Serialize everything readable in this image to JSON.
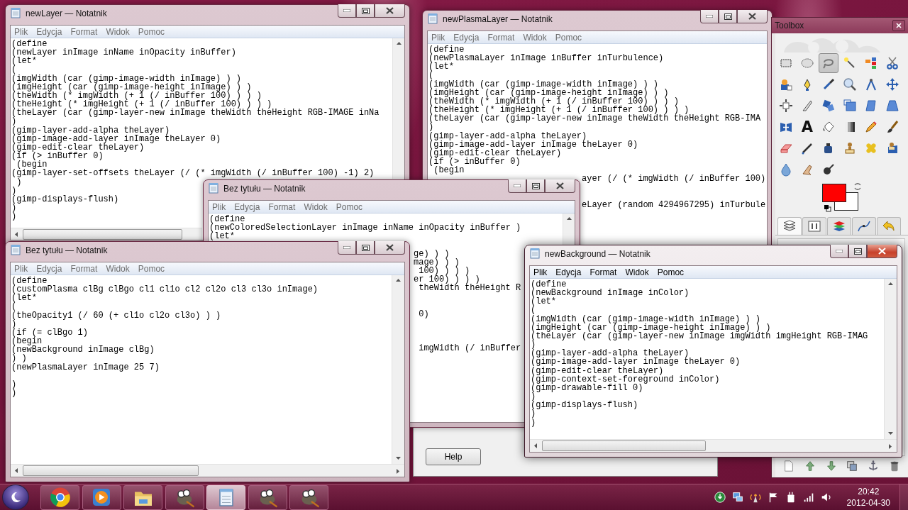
{
  "windows": [
    {
      "kind": "notepad",
      "title": "newLayer — Notatnik",
      "active": false,
      "menu": [
        "Plik",
        "Edycja",
        "Format",
        "Widok",
        "Pomoc"
      ],
      "text": "(define\n(newLayer inImage inName inOpacity inBuffer)\n(let*\n(\n(imgWidth (car (gimp-image-width inImage) ) )\n(imgHeight (car (gimp-image-height inImage) ) )\n(theWidth (* imgWidth (+ 1 (/ inBuffer 100) ) ) )\n(theHeight (* imgHeight (+ 1 (/ inBuffer 100) ) ) )\n(theLayer (car (gimp-layer-new inImage theWidth theHeight RGB-IMAGE inNa\n)\n(gimp-layer-add-alpha theLayer)\n(gimp-image-add-layer inImage theLayer 0)\n(gimp-edit-clear theLayer)\n(if (> inBuffer 0)\n (begin\n(gimp-layer-set-offsets theLayer (/ (* imgWidth (/ inBuffer 100) -1) 2)\n )\n)\n(gimp-displays-flush)\n)\n)"
    },
    {
      "kind": "notepad",
      "title": "newPlasmaLayer — Notatnik",
      "active": false,
      "menu": [
        "Plik",
        "Edycja",
        "Format",
        "Widok",
        "Pomoc"
      ],
      "text": "(define\n(newPlasmaLayer inImage inBuffer inTurbulence)\n(let*\n(\n(imgWidth (car (gimp-image-width inImage) ) )\n(imgHeight (car (gimp-image-height inImage) ) )\n(theWidth (* imgWidth (+ 1 (/ inBuffer 100) ) ) )\n(theHeight (* imgHeight (+ 1 (/ inBuffer 100) ) ) )\n(theLayer (car (gimp-layer-new inImage theWidth theHeight RGB-IMA\n)\n(gimp-layer-add-alpha theLayer)\n(gimp-image-add-layer inImage theLayer 0)\n(gimp-edit-clear theLayer)\n(if (> inBuffer 0)\n (begin",
      "fragments": [
        "ayer (/ (* imgWidth (/ inBuffer 100)",
        "eLayer (random 4294967295) inTurbule"
      ]
    },
    {
      "kind": "dialog",
      "button": "Help"
    },
    {
      "kind": "notepad",
      "title": "Bez tytułu — Notatnik",
      "active": false,
      "menu": [
        "Plik",
        "Edycja",
        "Format",
        "Widok",
        "Pomoc"
      ],
      "text": "(define\n(newColoredSelectionLayer inImage inName inOpacity inBuffer )\n(let*",
      "fragments": [
        "ge) ) )",
        "mage) ) )",
        "100) ) ) )",
        "er 100) ) ) )",
        "theWidth theHeight R",
        "0)",
        "imgWidth (/ inBuffer"
      ]
    },
    {
      "kind": "notepad",
      "title": "Bez tytułu — Notatnik",
      "active": false,
      "menu": [
        "Plik",
        "Edycja",
        "Format",
        "Widok",
        "Pomoc"
      ],
      "text": "(define\n(customPlasma clBg clBgo cl1 cl1o cl2 cl2o cl3 cl3o inImage)\n(let*\n(\n(theOpacity1 (/ 60 (+ cl1o cl2o cl3o) ) )\n)\n(if (= clBgo 1)\n(begin\n(newBackground inImage clBg)\n) )\n(newPlasmaLayer inImage 25 7)\n\n)\n)"
    },
    {
      "kind": "notepad",
      "title": "newBackground — Notatnik",
      "active": true,
      "menu": [
        "Plik",
        "Edycja",
        "Format",
        "Widok",
        "Pomoc"
      ],
      "text": "(define\n(newBackground inImage inColor)\n(let*\n(\n(imgWidth (car (gimp-image-width inImage) ) )\n(imgHeight (car (gimp-image-height inImage) ) )\n(theLayer (car (gimp-layer-new inImage imgWidth imgHeight RGB-IMAG\n)\n(gimp-layer-add-alpha theLayer)\n(gimp-image-add-layer inImage theLayer 0)\n(gimp-edit-clear theLayer)\n(gimp-context-set-foreground inColor)\n(gimp-drawable-fill 0)\n)\n(gimp-displays-flush)\n)\n)"
    }
  ],
  "toolbox": {
    "title": "Toolbox",
    "tools": [
      {
        "kind": "rect",
        "selected": false
      },
      {
        "kind": "ellipse",
        "selected": false
      },
      {
        "kind": "lasso",
        "selected": true
      },
      {
        "kind": "wand",
        "selected": false
      },
      {
        "kind": "color-select",
        "selected": false
      },
      {
        "kind": "scissors",
        "selected": false
      },
      {
        "kind": "foreground",
        "selected": false
      },
      {
        "kind": "paths",
        "selected": false
      },
      {
        "kind": "picker",
        "selected": false
      },
      {
        "kind": "zoom",
        "selected": false
      },
      {
        "kind": "measure",
        "selected": false
      },
      {
        "kind": "move",
        "selected": false
      },
      {
        "kind": "align",
        "selected": false
      },
      {
        "kind": "crop",
        "selected": false
      },
      {
        "kind": "rotate",
        "selected": false
      },
      {
        "kind": "scale",
        "selected": false
      },
      {
        "kind": "shear",
        "selected": false
      },
      {
        "kind": "perspective",
        "selected": false
      },
      {
        "kind": "flip",
        "selected": false
      },
      {
        "kind": "text",
        "glyph": "A",
        "selected": false
      },
      {
        "kind": "bucket",
        "selected": false
      },
      {
        "kind": "blend",
        "selected": false
      },
      {
        "kind": "pencil",
        "selected": false
      },
      {
        "kind": "brush",
        "selected": false
      },
      {
        "kind": "eraser",
        "selected": false
      },
      {
        "kind": "airbrush",
        "selected": false
      },
      {
        "kind": "ink",
        "selected": false
      },
      {
        "kind": "clone",
        "selected": false
      },
      {
        "kind": "heal",
        "selected": false
      },
      {
        "kind": "perspective-clone",
        "selected": false
      },
      {
        "kind": "blur",
        "selected": false
      },
      {
        "kind": "smudge",
        "selected": false
      },
      {
        "kind": "dodge",
        "selected": false
      }
    ],
    "colors": [
      {
        "color": "#ff0000"
      },
      {
        "color": "#ffffff"
      }
    ],
    "tabs": [
      {
        "kind": "layers",
        "selected": true
      },
      {
        "kind": "device",
        "selected": false
      },
      {
        "kind": "channels",
        "selected": false
      },
      {
        "kind": "paths",
        "selected": false
      },
      {
        "kind": "undo",
        "selected": false
      }
    ],
    "actions": [
      {
        "kind": "new"
      },
      {
        "kind": "raise"
      },
      {
        "kind": "lower"
      },
      {
        "kind": "duplicate"
      },
      {
        "kind": "anchor"
      },
      {
        "kind": "delete"
      }
    ]
  },
  "taskbar": {
    "apps": [
      {
        "kind": "browser",
        "selected": false
      },
      {
        "kind": "media",
        "selected": false
      },
      {
        "kind": "folder",
        "selected": false
      },
      {
        "kind": "gimp",
        "selected": false
      },
      {
        "kind": "notepad",
        "selected": true
      },
      {
        "kind": "gimp",
        "selected": false
      },
      {
        "kind": "gimp",
        "selected": false
      }
    ],
    "tray": [
      {
        "kind": "download"
      },
      {
        "kind": "network"
      },
      {
        "kind": "antenna"
      },
      {
        "kind": "flag"
      },
      {
        "kind": "power"
      },
      {
        "kind": "signal"
      },
      {
        "kind": "volume"
      }
    ],
    "time": "20:42",
    "date": "2012-04-30"
  }
}
